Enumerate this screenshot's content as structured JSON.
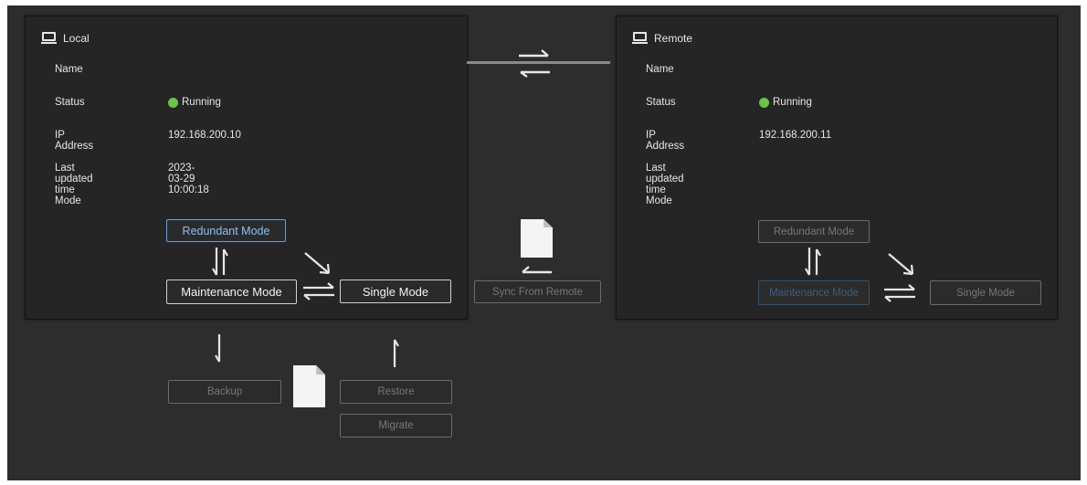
{
  "local": {
    "title": "Local",
    "fields": [
      {
        "label": "Name",
        "value": ""
      },
      {
        "label": "Status",
        "value": "Running"
      },
      {
        "label": "IP Address",
        "value": "192.168.200.10"
      },
      {
        "label": "Last updated time",
        "value": "2023-03-29 10:00:18"
      },
      {
        "label": "Mode",
        "value": ""
      }
    ],
    "modes": {
      "redundant": "Redundant Mode",
      "maintenance": "Maintenance Mode",
      "single": "Single Mode"
    },
    "current_mode": "Redundant Mode"
  },
  "remote": {
    "title": "Remote",
    "fields": [
      {
        "label": "Name",
        "value": ""
      },
      {
        "label": "Status",
        "value": "Running"
      },
      {
        "label": "IP Address",
        "value": "192.168.200.11"
      },
      {
        "label": "Last updated time",
        "value": ""
      },
      {
        "label": "Mode",
        "value": ""
      }
    ],
    "modes": {
      "redundant": "Redundant Mode",
      "maintenance": "Maintenance Mode",
      "single": "Single Mode"
    },
    "current_mode": "Maintenance Mode"
  },
  "sync": {
    "label": "Sync From Remote"
  },
  "actions": {
    "backup": "Backup",
    "restore": "Restore",
    "migrate": "Migrate"
  },
  "colors": {
    "status_running": "#6cc24a",
    "active_mode": "#6aa0d8",
    "background": "#2d2d2d"
  },
  "icons": [
    "monitor-icon",
    "document-icon",
    "swap-arrows-icon",
    "up-down-arrows-icon",
    "arrow-down-icon",
    "arrow-up-icon",
    "arrow-left-icon"
  ]
}
